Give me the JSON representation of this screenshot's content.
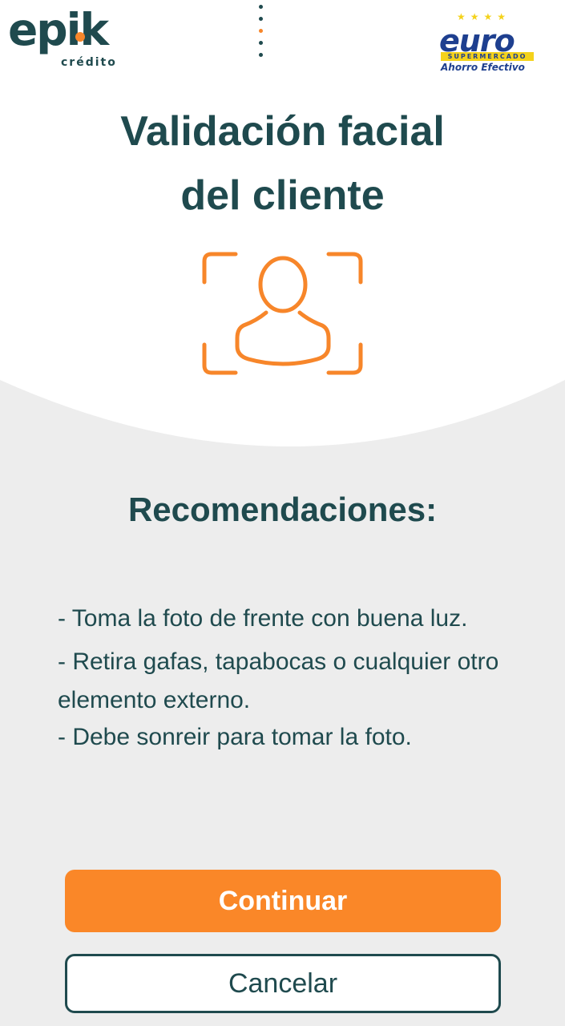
{
  "header": {
    "brand_left": {
      "name": "epik",
      "subtitle": "crédito"
    },
    "brand_right": {
      "name": "euro",
      "band": "SUPERMERCADO",
      "tagline": "Ahorro Efectivo"
    },
    "menu_icon": "vertical-dots-icon"
  },
  "main": {
    "title_line1": "Validación facial",
    "title_line2": "del cliente",
    "icon": "face-scan-icon",
    "recommendations_title": "Recomendaciones:",
    "recommendations": [
      "- Toma la foto de frente con buena luz.",
      "- Retira gafas, tapabocas o cualquier otro elemento externo.",
      "- Debe sonreir para tomar la foto."
    ]
  },
  "actions": {
    "continue_label": "Continuar",
    "cancel_label": "Cancelar"
  },
  "colors": {
    "primary": "#1f4a4e",
    "accent": "#fa8728",
    "background": "#ededed",
    "surface": "#ffffff"
  }
}
